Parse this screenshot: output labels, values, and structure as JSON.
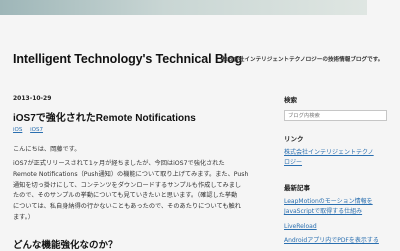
{
  "header": {
    "blog_title": "Intelligent Technology's Technical Blog",
    "blog_description": "株式会社インテリジェントテクノロジーの技術情報ブログです。"
  },
  "post": {
    "date": "2013-10-29",
    "title": "iOS7で強化されたRemote Notifications",
    "tags": [
      "iOS",
      "iOS7"
    ],
    "greeting": "こんにちは、岡藤です。",
    "body_lines": [
      "iOS7が正式リリースされて1ヶ月が経ちましたが、今回はiOS7で強化された",
      "Remote Notifications（Push通知）の機能について取り上げてみます。また、Push",
      "通知を切っ掛けにして、コンテンツをダウンロードするサンプルも作成してみまし",
      "たので、そのサンプルの挙動についても見ていきたいと思います。（確認した挙動",
      "については、私自身納得の行かないこともあったので、そのあたりについても触れ",
      "ます。）"
    ],
    "subheading": "どんな機能強化なのか？"
  },
  "sidebar": {
    "search_heading": "検索",
    "search_placeholder": "ブログ内検索",
    "links_heading": "リンク",
    "links": [
      "株式会社インテリジェントテクノ",
      "ロジー"
    ],
    "recent_heading": "最新記事",
    "recent_posts": [
      "LeapMotionのモーション情報を",
      "JavaScriptで取得する仕組み",
      "LiveReload",
      "Androidアプリ内でPDFを表示する"
    ]
  }
}
